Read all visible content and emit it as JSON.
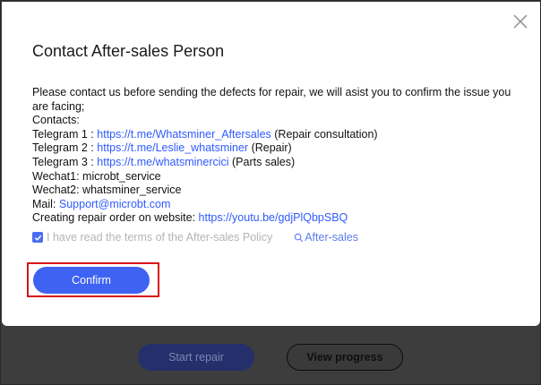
{
  "modal": {
    "title": "Contact After-sales Person",
    "intro_line1": "Please contact us before sending the defects for repair, we will asist you to confirm the issue you",
    "intro_line2": "are facing;",
    "contacts_label": "Contacts:",
    "telegram1": {
      "label": "Telegram 1 : ",
      "link": "https://t.me/Whatsminer_Aftersales",
      "note": " (Repair consultation)"
    },
    "telegram2": {
      "label": "Telegram 2 : ",
      "link": "https://t.me/Leslie_whatsminer",
      "note": " (Repair)"
    },
    "telegram3": {
      "label": "Telegram 3 : ",
      "link": "https://t.me/whatsminercici",
      "note": " (Parts sales)"
    },
    "wechat1": "Wechat1: microbt_service",
    "wechat2": "Wechat2: whatsminer_service",
    "mail": {
      "label": "Mail: ",
      "link": "Support@microbt.com"
    },
    "repair_order": {
      "label": "Creating repair order on website: ",
      "link": "https://youtu.be/gdjPlQbpSBQ"
    },
    "agree_text": "I have read the terms of the After-sales Policy",
    "policy_link": "After-sales",
    "confirm_label": "Confirm"
  },
  "background": {
    "start_repair_label": "Start repair",
    "view_progress_label": "View progress"
  },
  "colors": {
    "accent": "#3e62f2",
    "link": "#2f5bff",
    "highlight": "#d9141b",
    "overlay": "#3d3d3d"
  },
  "icons": {
    "close": "close-icon",
    "checkbox": "checkmark-icon",
    "search": "search-icon"
  },
  "state": {
    "agree_checked": true
  }
}
